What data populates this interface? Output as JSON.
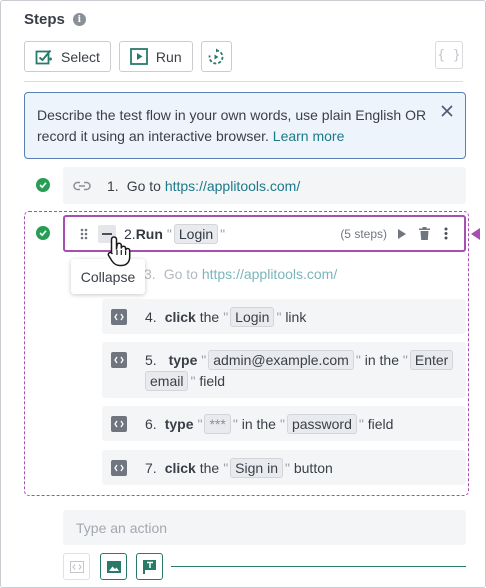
{
  "header": {
    "title": "Steps",
    "info_icon": "info-icon"
  },
  "toolbar": {
    "select_label": "Select",
    "run_label": "Run",
    "json_label": "{ }"
  },
  "banner": {
    "text": "Describe the test flow in your own words, use plain English OR record it using an interactive browser.",
    "link": "Learn more"
  },
  "steps": {
    "s1": {
      "num": "1.",
      "text": "Go to",
      "url": "https://applitools.com/"
    },
    "s2": {
      "num": "2.",
      "verb": "Run",
      "chip": "Login",
      "count": "(5 steps)"
    },
    "s3": {
      "num": "3.",
      "text": "Go to",
      "url": "https://applitools.com/"
    },
    "s4": {
      "num": "4.",
      "verb": "click",
      "pre": "the",
      "chip": "Login",
      "post": "link"
    },
    "s5": {
      "num": "5.",
      "verb": "type",
      "chip": "admin@example.com",
      "mid": "in the",
      "chip2a": "Enter",
      "chip2b": "email",
      "post": "field"
    },
    "s6": {
      "num": "6.",
      "verb": "type",
      "chip": "***",
      "mid": "in the",
      "chip2": "password",
      "post": "field"
    },
    "s7": {
      "num": "7.",
      "verb": "click",
      "pre": "the",
      "chip": "Sign in",
      "post": "button"
    }
  },
  "tooltip": {
    "text": "Collapse"
  },
  "action_input": {
    "placeholder": "Type an action"
  },
  "colors": {
    "accent": "#a64fb0",
    "success": "#2a9d55",
    "link": "#1a7a8a",
    "banner_border": "#5a7fb5"
  }
}
